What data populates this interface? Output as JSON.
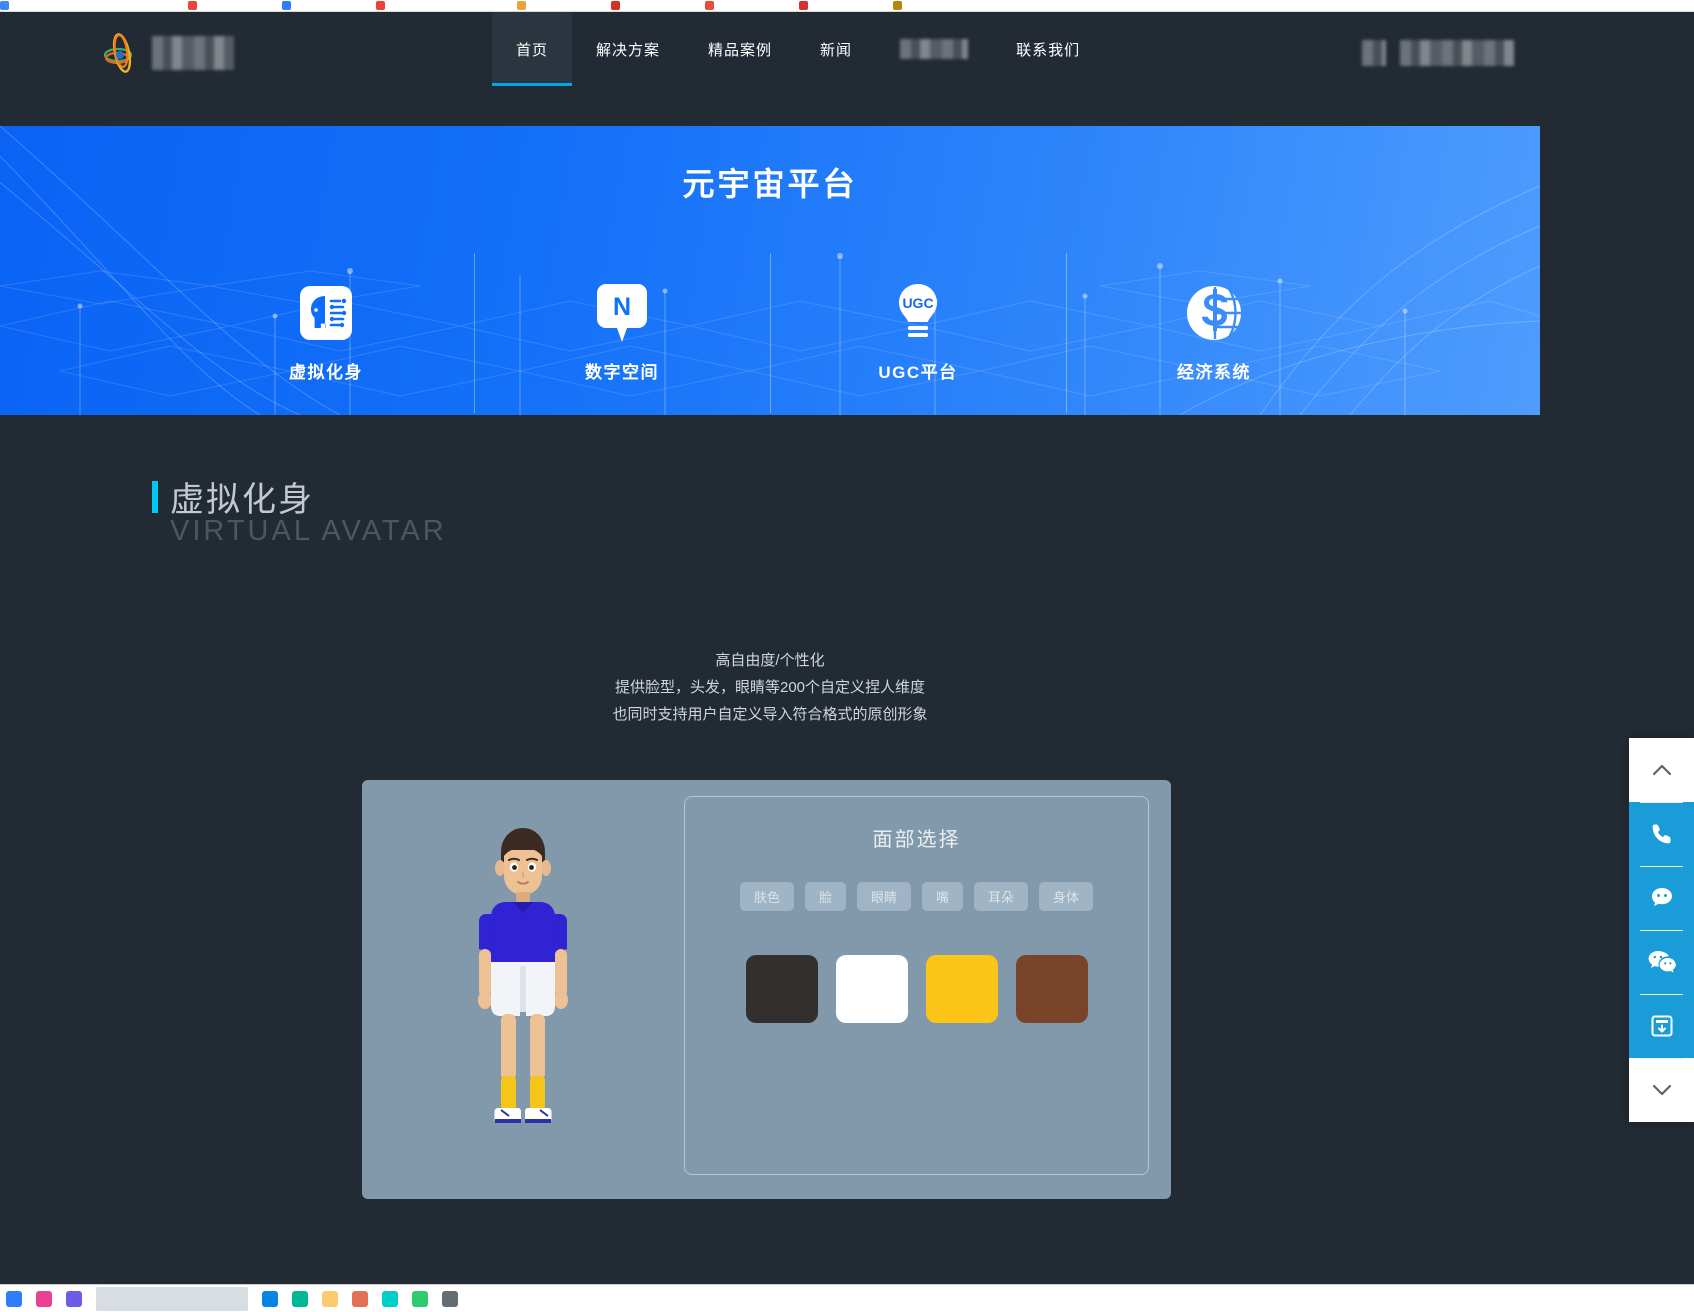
{
  "browser": {
    "bookmarks": [
      {
        "label": "",
        "color": "#4285f4"
      },
      {
        "label": "",
        "color": "#ffffff"
      },
      {
        "label": "",
        "color": "#ffffff"
      },
      {
        "label": "",
        "color": "#ffffff"
      },
      {
        "label": "",
        "color": "#e8453c"
      },
      {
        "label": "",
        "color": "#ffffff"
      },
      {
        "label": "",
        "color": "#2d7ff9"
      },
      {
        "label": "",
        "color": "#ffffff"
      },
      {
        "label": "",
        "color": "#ea4335"
      },
      {
        "label": "",
        "color": "#ffffff"
      },
      {
        "label": "",
        "color": "#ffffff"
      },
      {
        "label": "",
        "color": "#e8a33d"
      },
      {
        "label": "",
        "color": "#ffffff"
      },
      {
        "label": "",
        "color": "#d93025"
      },
      {
        "label": "",
        "color": "#ffffff"
      },
      {
        "label": "",
        "color": "#e74c3c"
      },
      {
        "label": "",
        "color": "#ffffff"
      },
      {
        "label": "",
        "color": "#d63031"
      },
      {
        "label": "",
        "color": "#ffffff"
      },
      {
        "label": "",
        "color": "#b8860b"
      }
    ],
    "taskbar_icons": [
      "#2d7ff9",
      "#e84393",
      "#6c5ce7",
      "#0984e3",
      "#00b894",
      "#fdcb6e",
      "#e17055",
      "#00cec9",
      "#2ecc71",
      "#636e72"
    ]
  },
  "header": {
    "logo_name_redacted": true,
    "nav": [
      {
        "label": "首页",
        "active": true,
        "redacted": false
      },
      {
        "label": "解决方案",
        "active": false,
        "redacted": false
      },
      {
        "label": "精品案例",
        "active": false,
        "redacted": false
      },
      {
        "label": "新闻",
        "active": false,
        "redacted": false
      },
      {
        "label": "",
        "active": false,
        "redacted": true
      },
      {
        "label": "联系我们",
        "active": false,
        "redacted": false
      }
    ],
    "right_redacted": true
  },
  "banner": {
    "title": "元宇宙平台",
    "features": [
      {
        "label": "虚拟化身",
        "icon": "brain-head-icon"
      },
      {
        "label": "数字空间",
        "icon": "navigation-pin-icon"
      },
      {
        "label": "UGC平台",
        "icon": "lightbulb-ugc-icon"
      },
      {
        "label": "经济系统",
        "icon": "dollar-globe-icon"
      }
    ],
    "bg_color_start": "#0a63f5",
    "bg_color_end": "#4f9cfd"
  },
  "section": {
    "title_cn": "虚拟化身",
    "title_en": "VIRTUAL AVATAR",
    "accent_color": "#00c8f0",
    "description": [
      "高自由度/个性化",
      "提供脸型，头发，眼睛等200个自定义捏人维度",
      "也同时支持用户自定义导入符合格式的原创形象"
    ]
  },
  "editor": {
    "panel_title": "面部选择",
    "chips": [
      "肤色",
      "脸",
      "眼睛",
      "嘴",
      "耳朵",
      "身体"
    ],
    "swatches": [
      {
        "name": "dark",
        "color": "#332f2e"
      },
      {
        "name": "white",
        "color": "#ffffff"
      },
      {
        "name": "yellow",
        "color": "#fbc417"
      },
      {
        "name": "brown",
        "color": "#79442a"
      }
    ],
    "avatar": {
      "skin": "#e8b98f",
      "hair": "#3b2a22",
      "shirt": "#3023d4",
      "shorts": "#f2f4f7",
      "socks": "#f5c518",
      "shoes": "#ffffff"
    },
    "card_bg": "#8199ab"
  },
  "side_tools": [
    {
      "name": "chevron-up-icon",
      "label": "",
      "style": "plain"
    },
    {
      "name": "phone-icon",
      "label": "",
      "style": "accent"
    },
    {
      "name": "message-icon",
      "label": "",
      "style": "accent"
    },
    {
      "name": "wechat-icon",
      "label": "",
      "style": "accent"
    },
    {
      "name": "qrcode-icon",
      "label": "",
      "style": "accent"
    },
    {
      "name": "chevron-down-icon",
      "label": "",
      "style": "plain"
    }
  ]
}
